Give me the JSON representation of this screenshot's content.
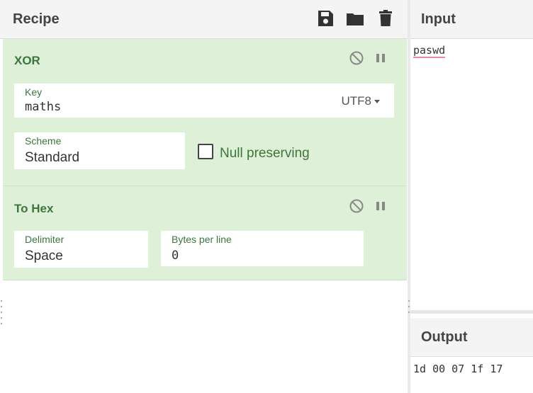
{
  "recipe": {
    "title": "Recipe",
    "icons": [
      "save-icon",
      "folder-open-icon",
      "trash-icon"
    ]
  },
  "operations": [
    {
      "name": "XOR",
      "fields": {
        "key_label": "Key",
        "key_value": "maths",
        "key_encoding": "UTF8",
        "scheme_label": "Scheme",
        "scheme_value": "Standard",
        "null_preserving_label": "Null preserving",
        "null_preserving_checked": false
      }
    },
    {
      "name": "To Hex",
      "fields": {
        "delimiter_label": "Delimiter",
        "delimiter_value": "Space",
        "bytes_per_line_label": "Bytes per line",
        "bytes_per_line_value": "0"
      }
    }
  ],
  "input": {
    "title": "Input",
    "text": "paswd"
  },
  "output": {
    "title": "Output",
    "text": "1d 00 07 1f 17"
  },
  "colors": {
    "op_bg": "#dff0d8",
    "op_title": "#3c763d",
    "header_bg": "#f4f4f4"
  }
}
